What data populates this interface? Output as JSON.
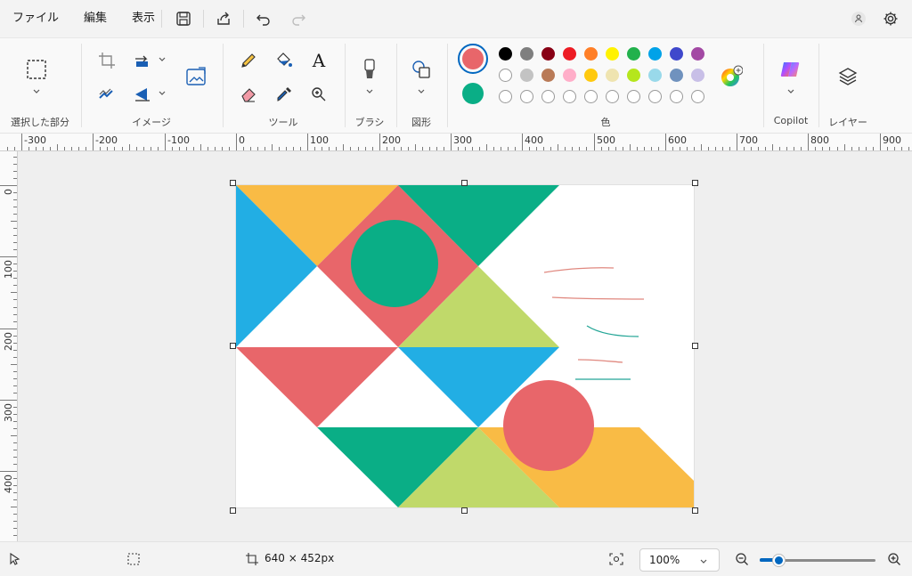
{
  "menu": {
    "file": "ファイル",
    "edit": "編集",
    "view": "表示"
  },
  "ribbon": {
    "groups": {
      "selection": "選択した部分",
      "image": "イメージ",
      "tools": "ツール",
      "brush": "ブラシ",
      "shapes": "図形",
      "color": "色",
      "copilot": "Copilot",
      "layers": "レイヤー"
    },
    "text_tool_glyph": "A"
  },
  "colors": {
    "primary": "#e8666a",
    "secondary": "#0aae86",
    "palette_row1": [
      "#000000",
      "#7f7f7f",
      "#880015",
      "#ed1c24",
      "#ff7f27",
      "#fff200",
      "#22b14c",
      "#00a2e8",
      "#3f48cc",
      "#a349a4"
    ],
    "palette_row2": [
      "#ffffff",
      "#c3c3c3",
      "#b97a57",
      "#ffaec9",
      "#ffc90e",
      "#efe4b0",
      "#b5e61d",
      "#99d9ea",
      "#7092be",
      "#c8bfe7"
    ],
    "accent": "#0067c0"
  },
  "rulers": {
    "horizontal": [
      "-300",
      "-200",
      "-100",
      "0",
      "100",
      "200",
      "300",
      "400",
      "500",
      "600",
      "700",
      "800",
      "900"
    ],
    "vertical": [
      "0",
      "100",
      "200",
      "300",
      "400"
    ]
  },
  "status": {
    "canvas_size": "640 × 452px",
    "zoom": "100%"
  }
}
